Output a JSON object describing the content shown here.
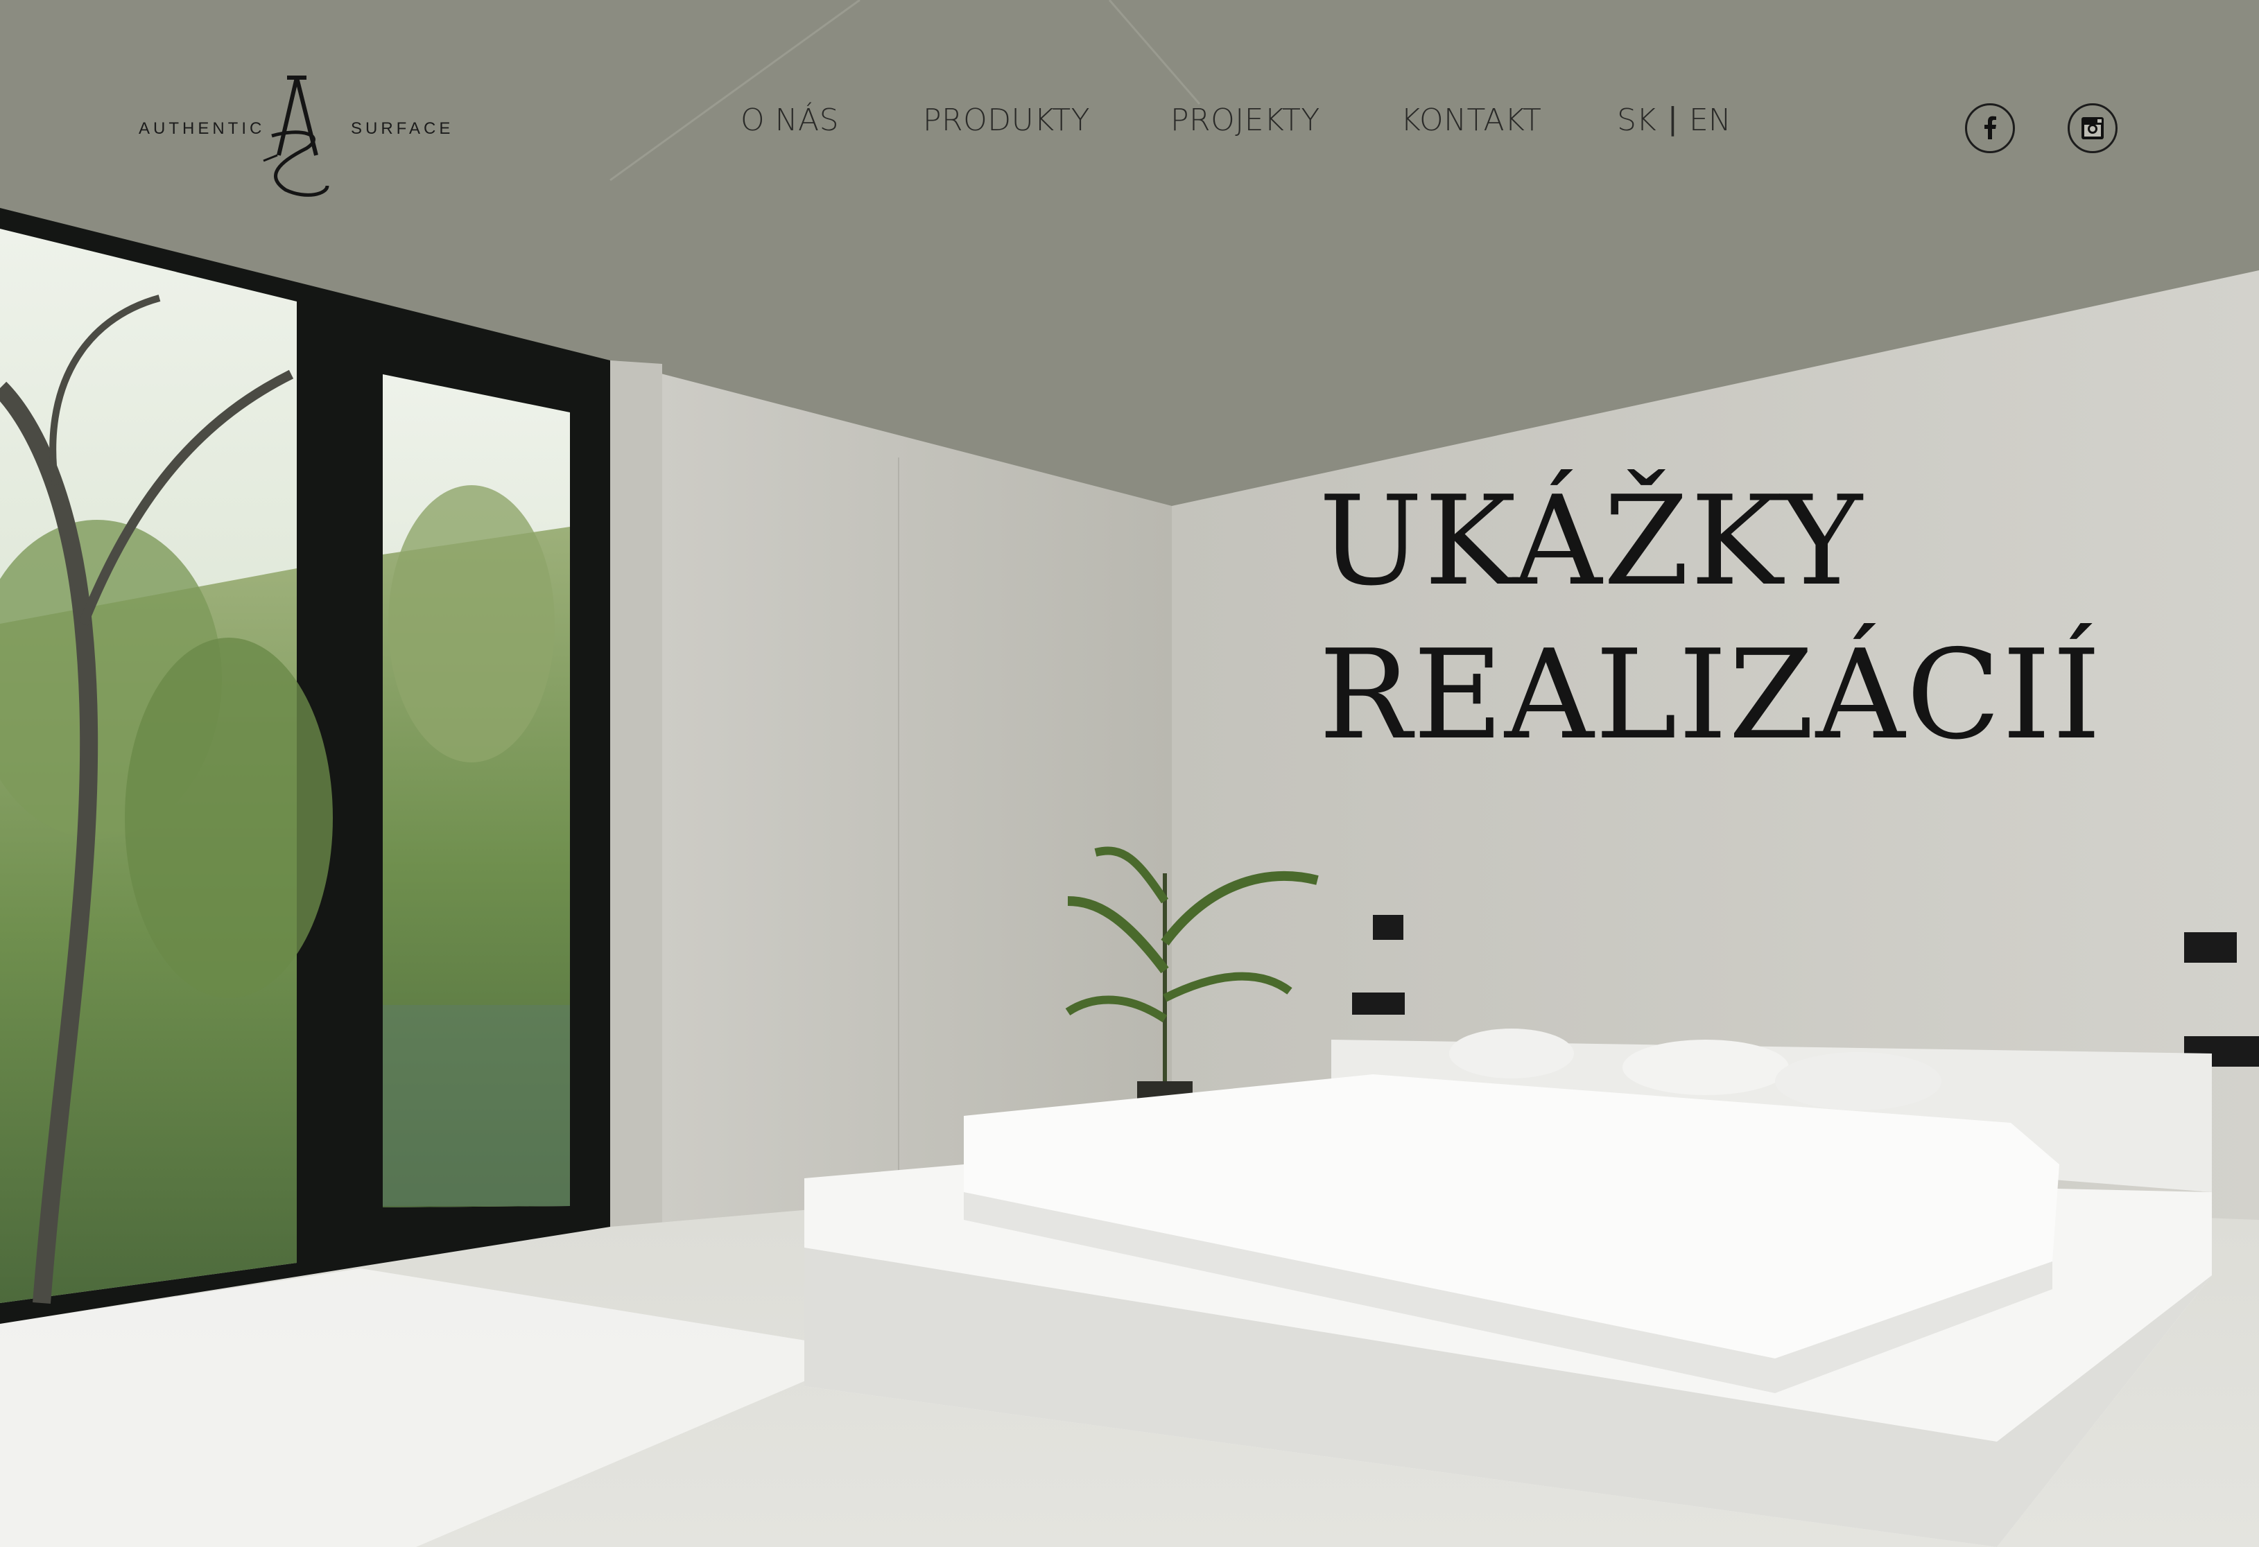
{
  "brand": {
    "left_word": "AUTHENTIC",
    "right_word": "SURFACE",
    "monogram": "AS"
  },
  "nav": {
    "items": [
      {
        "label": "O NÁS"
      },
      {
        "label": "PRODUKTY"
      },
      {
        "label": "PROJEKTY"
      },
      {
        "label": "KONTAKT"
      }
    ]
  },
  "language": {
    "options": [
      "SK",
      "EN"
    ],
    "separator": "|"
  },
  "social": {
    "icons": [
      "facebook-icon",
      "instagram-icon"
    ]
  },
  "hero": {
    "title_line1": "UKÁŽKY",
    "title_line2": "REALIZÁCIÍ"
  },
  "colors": {
    "text": "#1c1c1c",
    "ceiling": "#8a8a7e",
    "wall": "#c9c8c1",
    "floor": "#e6e6e1",
    "bed": "#f4f4f2"
  }
}
